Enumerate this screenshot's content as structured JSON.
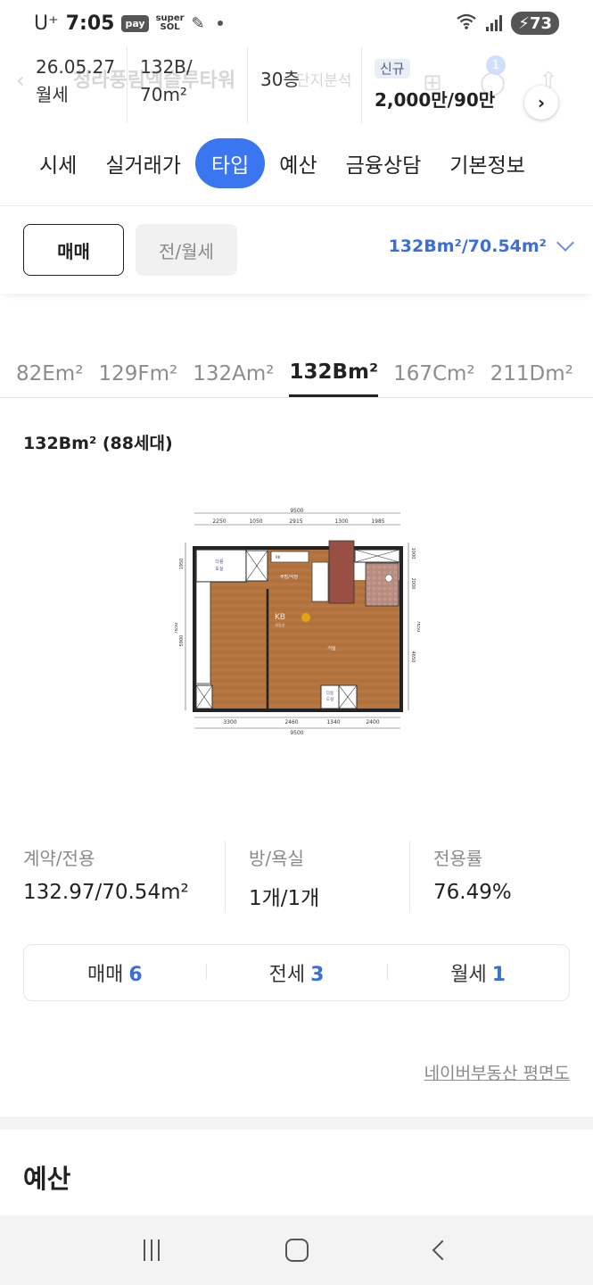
{
  "status_bar": {
    "carrier": "U⁺",
    "time": "7:05",
    "pay_label": "pay",
    "supersol_top": "super",
    "supersol_bottom": "SOL",
    "battery": "73"
  },
  "info_bar": {
    "ghost_title": "청라풍림엑슬루타워",
    "ghost_right": "단지분석",
    "date": "26.05.27",
    "deal_kind": "월세",
    "type_line1": "132B/",
    "type_line2": "70m²",
    "floor": "30층",
    "badge": "신규",
    "price": "2,000만/90만",
    "ghost_badge_count": "1"
  },
  "main_tabs": [
    {
      "label": "시세",
      "active": false
    },
    {
      "label": "실거래가",
      "active": false
    },
    {
      "label": "타입",
      "active": true
    },
    {
      "label": "예산",
      "active": false
    },
    {
      "label": "금융상담",
      "active": false
    },
    {
      "label": "기본정보",
      "active": false
    }
  ],
  "deal_filter": {
    "sale_label": "매매",
    "lease_label": "전/월세",
    "selected_area": "132Bm²/70.54m²"
  },
  "type_tabs": [
    {
      "label": "82Em²",
      "active": false
    },
    {
      "label": "129Fm²",
      "active": false
    },
    {
      "label": "132Am²",
      "active": false
    },
    {
      "label": "132Bm²",
      "active": true
    },
    {
      "label": "167Cm²",
      "active": false
    },
    {
      "label": "211Dm²",
      "active": false
    }
  ],
  "type_title": "132Bm² (88세대)",
  "floorplan": {
    "top_total": "9500",
    "top_dims": [
      "2250",
      "1050",
      "2915",
      "1300",
      "1985"
    ],
    "bottom_total": "9500",
    "bottom_dims": [
      "3300",
      "2460",
      "1340",
      "2400"
    ],
    "left_dims": [
      "1950",
      "7650",
      "5900"
    ],
    "right_dims": [
      "1000",
      "2000",
      "4650",
      "7650"
    ],
    "room_kitchen": "주방/식당",
    "room_living": "거실",
    "room_storage_a": "다용",
    "room_storage_b": "도실",
    "watermark_kb": "KB",
    "watermark_sub": "부동산",
    "label_rk": "RK"
  },
  "stats": [
    {
      "label": "계약/전용",
      "value": "132.97/70.54m²"
    },
    {
      "label": "방/욕실",
      "value": "1개/1개"
    },
    {
      "label": "전용률",
      "value": "76.49%"
    }
  ],
  "counts": [
    {
      "label": "매매",
      "value": "6"
    },
    {
      "label": "전세",
      "value": "3"
    },
    {
      "label": "월세",
      "value": "1"
    }
  ],
  "naver_link": "네이버부동산 평면도",
  "section_title": "예산"
}
